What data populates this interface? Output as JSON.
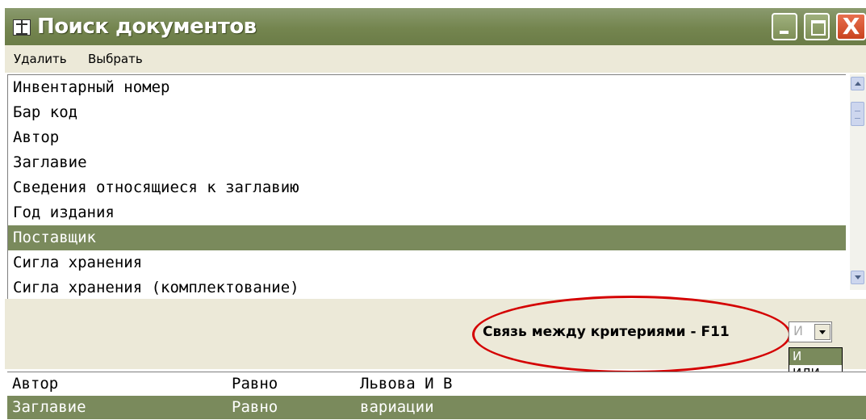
{
  "window": {
    "title": "Поиск документов",
    "close_glyph": "X",
    "icon": "book-icon"
  },
  "menu": {
    "items": [
      {
        "label": "Удалить"
      },
      {
        "label": "Выбрать"
      }
    ]
  },
  "fields": {
    "items": [
      "Инвентарный номер",
      "Бар код",
      "Автор",
      "Заглавие",
      "Сведения относящиеся к заглавию",
      "Год издания",
      "Поставщик",
      "Сигла хранения",
      "Сигла хранения (комплектование)"
    ],
    "selected_index": 6
  },
  "criteria_link": {
    "label": "Связь между критериями - F11",
    "selected": "И",
    "options": [
      "И",
      "ИЛИ"
    ],
    "highlight_color": "#d40000"
  },
  "criteria": [
    {
      "field": "Автор",
      "operator": "Равно",
      "value": "Львова И В"
    },
    {
      "field": "Заглавие",
      "operator": "Равно",
      "value": "вариации"
    }
  ],
  "colors": {
    "selection": "#7a8a5c",
    "titlebar": "#74854f",
    "close_button": "#c9431f"
  }
}
